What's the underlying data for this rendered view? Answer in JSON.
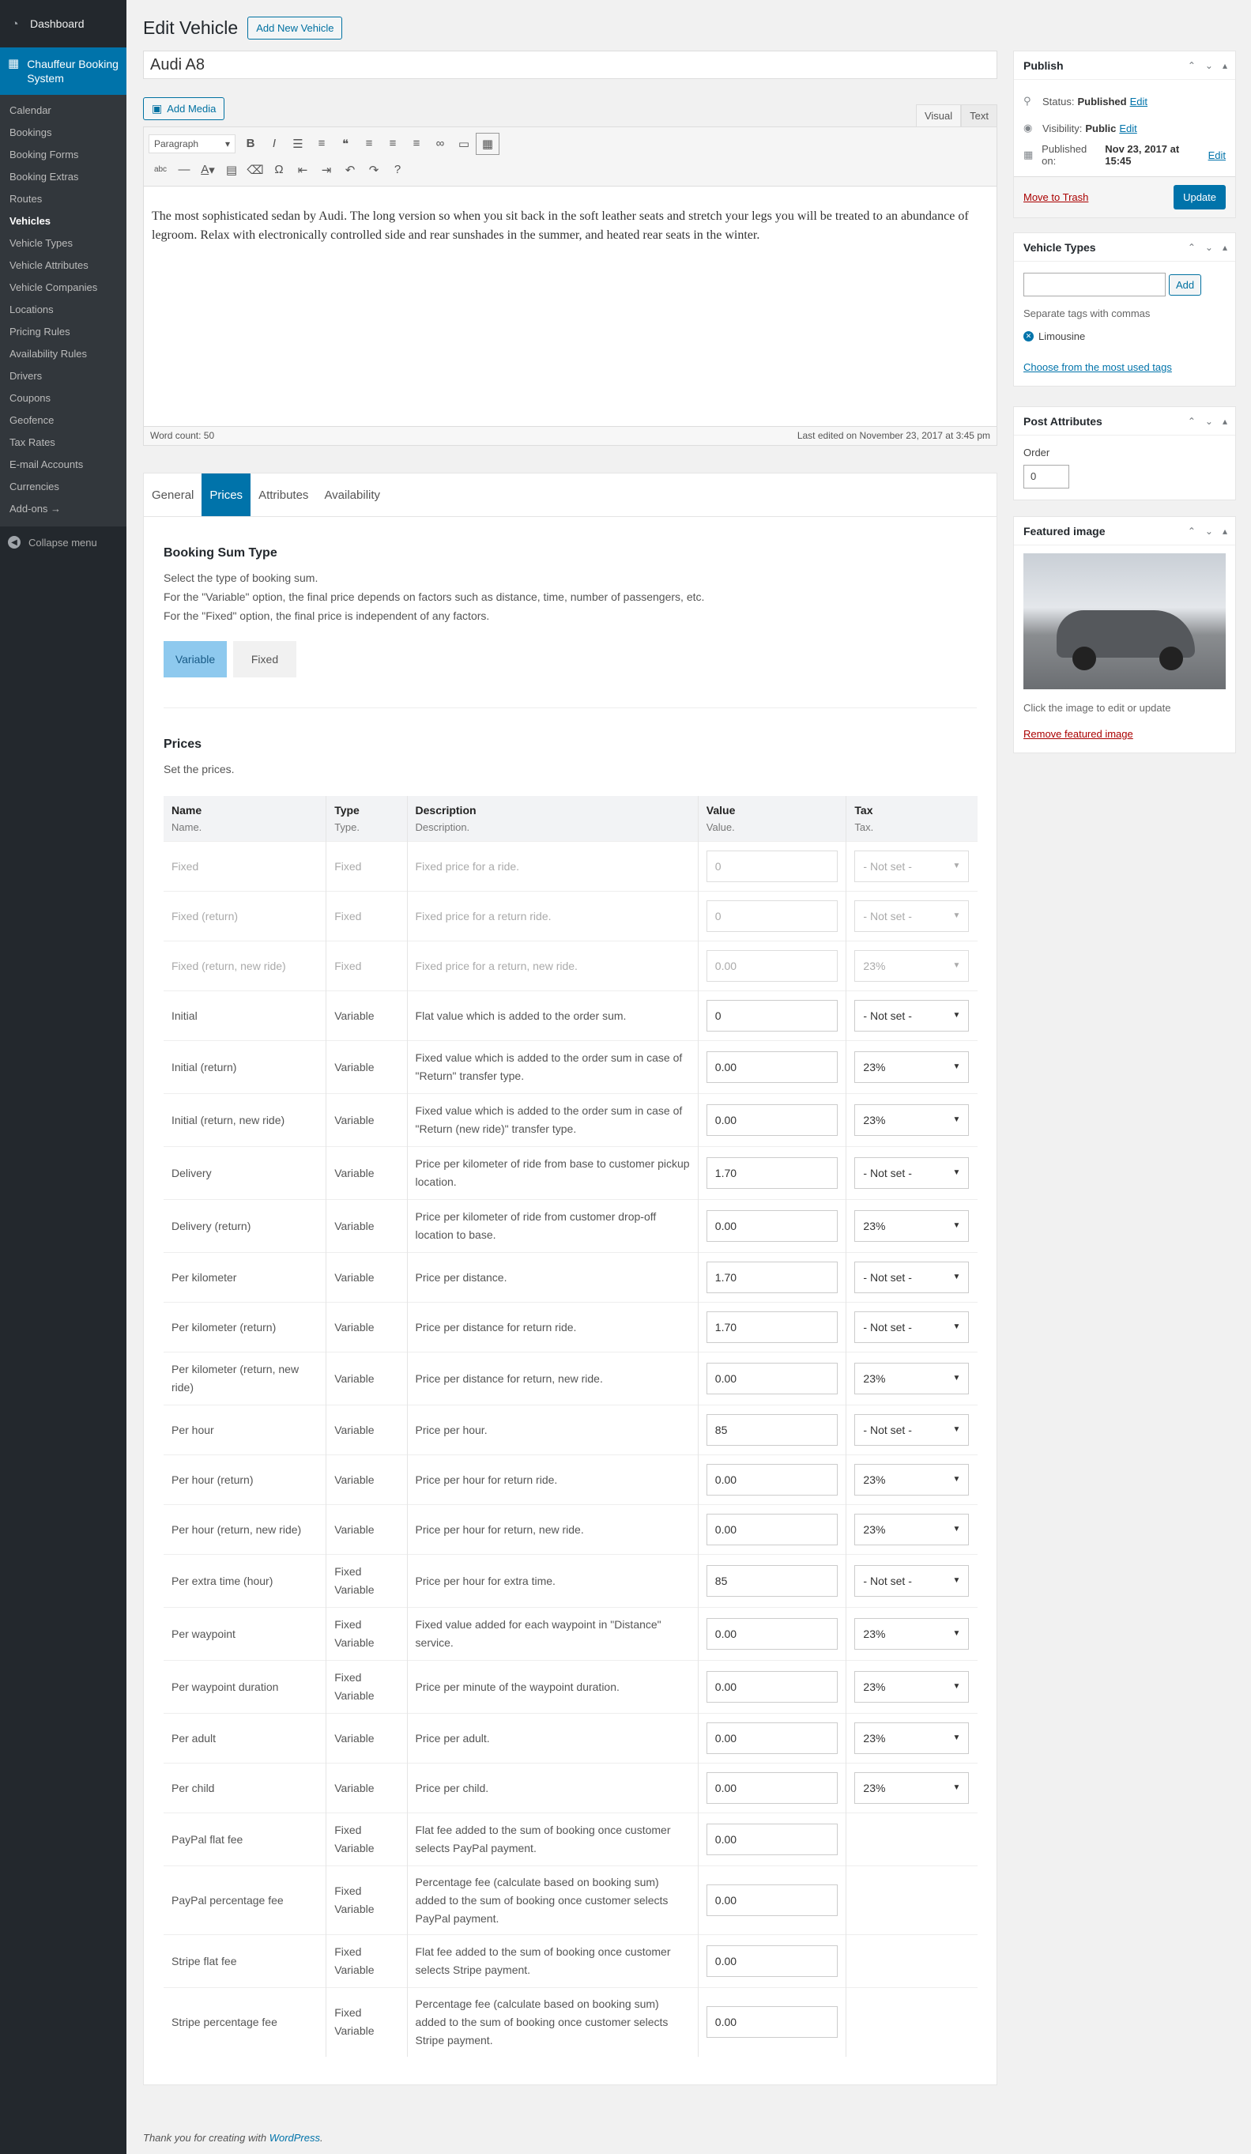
{
  "sidebar": {
    "dashboard": "Dashboard",
    "active_menu": "Chauffeur Booking System",
    "items": [
      {
        "label": "Calendar"
      },
      {
        "label": "Bookings"
      },
      {
        "label": "Booking Forms"
      },
      {
        "label": "Booking Extras"
      },
      {
        "label": "Routes"
      },
      {
        "label": "Vehicles"
      },
      {
        "label": "Vehicle Types"
      },
      {
        "label": "Vehicle Attributes"
      },
      {
        "label": "Vehicle Companies"
      },
      {
        "label": "Locations"
      },
      {
        "label": "Pricing Rules"
      },
      {
        "label": "Availability Rules"
      },
      {
        "label": "Drivers"
      },
      {
        "label": "Coupons"
      },
      {
        "label": "Geofence"
      },
      {
        "label": "Tax Rates"
      },
      {
        "label": "E-mail Accounts"
      },
      {
        "label": "Currencies"
      },
      {
        "label": "Add-ons →"
      }
    ],
    "collapse": "Collapse menu"
  },
  "header": {
    "title": "Edit Vehicle",
    "add_new": "Add New Vehicle"
  },
  "post": {
    "title": "Audi A8",
    "add_media": "Add Media",
    "tab_visual": "Visual",
    "tab_text": "Text",
    "format": "Paragraph",
    "content": "The most sophisticated sedan by Audi. The long version so when you sit back in the soft leather seats and stretch your legs you will be treated to an abundance of legroom. Relax with electronically controlled side and rear sunshades in the summer, and heated rear seats in the winter.",
    "word_count": "Word count: 50",
    "last_edited": "Last edited on November 23, 2017 at 3:45 pm"
  },
  "tabs": [
    "General",
    "Prices",
    "Attributes",
    "Availability"
  ],
  "booking_sum": {
    "title": "Booking Sum Type",
    "desc1": "Select the type of booking sum.",
    "desc2": "For the \"Variable\" option, the final price depends on factors such as distance, time, number of passengers, etc.",
    "desc3": "For the \"Fixed\" option, the final price is independent of any factors.",
    "opt_variable": "Variable",
    "opt_fixed": "Fixed"
  },
  "prices": {
    "title": "Prices",
    "desc": "Set the prices.",
    "headers": [
      {
        "title": "Name",
        "sub": "Name."
      },
      {
        "title": "Type",
        "sub": "Type."
      },
      {
        "title": "Description",
        "sub": "Description."
      },
      {
        "title": "Value",
        "sub": "Value."
      },
      {
        "title": "Tax",
        "sub": "Tax."
      }
    ],
    "rows": [
      {
        "name": "Fixed",
        "type": "Fixed",
        "desc": "Fixed price for a ride.",
        "value": "0",
        "tax": "- Not set -",
        "disabled": true
      },
      {
        "name": "Fixed (return)",
        "type": "Fixed",
        "desc": "Fixed price for a return ride.",
        "value": "0",
        "tax": "- Not set -",
        "disabled": true
      },
      {
        "name": "Fixed (return, new ride)",
        "type": "Fixed",
        "desc": "Fixed price for a return, new ride.",
        "value": "0.00",
        "tax": "23%",
        "disabled": true
      },
      {
        "name": "Initial",
        "type": "Variable",
        "desc": "Flat value which is added to the order sum.",
        "value": "0",
        "tax": "- Not set -"
      },
      {
        "name": "Initial (return)",
        "type": "Variable",
        "desc": "Fixed value which is added to the order sum in case of \"Return\" transfer type.",
        "value": "0.00",
        "tax": "23%"
      },
      {
        "name": "Initial (return, new ride)",
        "type": "Variable",
        "desc": "Fixed value which is added to the order sum in case of \"Return (new ride)\" transfer type.",
        "value": "0.00",
        "tax": "23%"
      },
      {
        "name": "Delivery",
        "type": "Variable",
        "desc": "Price per kilometer of ride from base to customer pickup location.",
        "value": "1.70",
        "tax": "- Not set -"
      },
      {
        "name": "Delivery (return)",
        "type": "Variable",
        "desc": "Price per kilometer of ride from customer drop-off location to base.",
        "value": "0.00",
        "tax": "23%"
      },
      {
        "name": "Per kilometer",
        "type": "Variable",
        "desc": "Price per distance.",
        "value": "1.70",
        "tax": "- Not set -"
      },
      {
        "name": "Per kilometer (return)",
        "type": "Variable",
        "desc": "Price per distance for return ride.",
        "value": "1.70",
        "tax": "- Not set -"
      },
      {
        "name": "Per kilometer (return, new ride)",
        "type": "Variable",
        "desc": "Price per distance for return, new ride.",
        "value": "0.00",
        "tax": "23%"
      },
      {
        "name": "Per hour",
        "type": "Variable",
        "desc": "Price per hour.",
        "value": "85",
        "tax": "- Not set -"
      },
      {
        "name": "Per hour (return)",
        "type": "Variable",
        "desc": "Price per hour for return ride.",
        "value": "0.00",
        "tax": "23%"
      },
      {
        "name": "Per hour (return, new ride)",
        "type": "Variable",
        "desc": "Price per hour for return, new ride.",
        "value": "0.00",
        "tax": "23%"
      },
      {
        "name": "Per extra time (hour)",
        "type": "Fixed Variable",
        "desc": "Price per hour for extra time.",
        "value": "85",
        "tax": "- Not set -"
      },
      {
        "name": "Per waypoint",
        "type": "Fixed Variable",
        "desc": "Fixed value added for each waypoint in \"Distance\" service.",
        "value": "0.00",
        "tax": "23%"
      },
      {
        "name": "Per waypoint duration",
        "type": "Fixed Variable",
        "desc": "Price per minute of the waypoint duration.",
        "value": "0.00",
        "tax": "23%"
      },
      {
        "name": "Per adult",
        "type": "Variable",
        "desc": "Price per adult.",
        "value": "0.00",
        "tax": "23%"
      },
      {
        "name": "Per child",
        "type": "Variable",
        "desc": "Price per child.",
        "value": "0.00",
        "tax": "23%"
      },
      {
        "name": "PayPal flat fee",
        "type": "Fixed Variable",
        "desc": "Flat fee added to the sum of booking once customer selects PayPal payment.",
        "value": "0.00",
        "tax": ""
      },
      {
        "name": "PayPal percentage fee",
        "type": "Fixed Variable",
        "desc": "Percentage fee (calculate based on booking sum) added to the sum of booking once customer selects PayPal payment.",
        "value": "0.00",
        "tax": ""
      },
      {
        "name": "Stripe flat fee",
        "type": "Fixed Variable",
        "desc": "Flat fee added to the sum of booking once customer selects Stripe payment.",
        "value": "0.00",
        "tax": ""
      },
      {
        "name": "Stripe percentage fee",
        "type": "Fixed Variable",
        "desc": "Percentage fee (calculate based on booking sum) added to the sum of booking once customer selects Stripe payment.",
        "value": "0.00",
        "tax": ""
      }
    ]
  },
  "publish": {
    "title": "Publish",
    "status_label": "Status:",
    "status_value": "Published",
    "visibility_label": "Visibility:",
    "visibility_value": "Public",
    "published_label": "Published on:",
    "published_value": "Nov 23, 2017 at 15:45",
    "edit": "Edit",
    "trash": "Move to Trash",
    "update": "Update"
  },
  "vehicle_types": {
    "title": "Vehicle Types",
    "add": "Add",
    "hint": "Separate tags with commas",
    "tag": "Limousine",
    "choose": "Choose from the most used tags"
  },
  "post_attributes": {
    "title": "Post Attributes",
    "order_label": "Order",
    "order_value": "0"
  },
  "featured_image": {
    "title": "Featured image",
    "hint": "Click the image to edit or update",
    "remove": "Remove featured image"
  },
  "footer": {
    "text": "Thank you for creating with",
    "link": "WordPress",
    "dot": "."
  },
  "colors": {
    "sidebar_bg": "#23282d",
    "accent": "#0073aa",
    "toggle_active": "#8ec9ee"
  }
}
